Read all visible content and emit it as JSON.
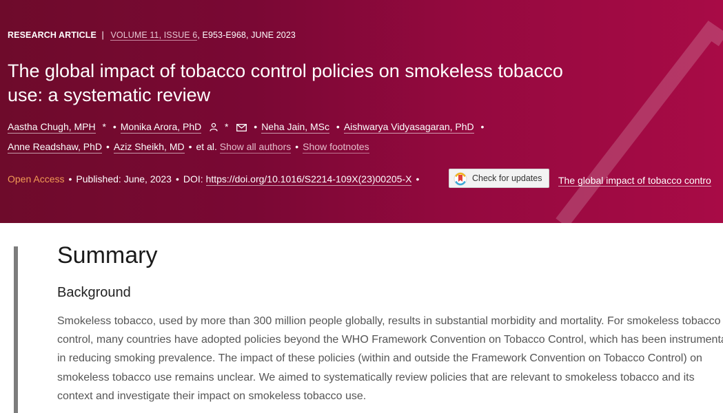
{
  "article": {
    "type": "RESEARCH ARTICLE",
    "separator": "|",
    "volume_issue": "VOLUME 11, ISSUE 6",
    "pages_date": ", E953-E968, JUNE 2023",
    "title": "The global impact of tobacco control policies on smokeless tobacco use: a systematic review"
  },
  "authors": {
    "a1": "Aastha Chugh, MPH",
    "a2": "Monika Arora, PhD",
    "a3": "Neha Jain, MSc",
    "a4": "Aishwarya Vidyasagaran, PhD",
    "a5": "Anne Readshaw, PhD",
    "a6": "Aziz Sheikh, MD",
    "etal": "et al.",
    "show_all": "Show all authors",
    "show_footnotes": "Show footnotes",
    "star": "*",
    "dot": "•"
  },
  "publication": {
    "open_access": "Open Access",
    "published_label": "Published:",
    "published_date": "June, 2023",
    "doi_label": "DOI:",
    "doi": "https://doi.org/10.1016/S2214-109X(23)00205-X",
    "check_updates": "Check for updates",
    "short_title": "The global impact of tobacco contro"
  },
  "summary": {
    "heading": "Summary",
    "subheading": "Background",
    "text": "Smokeless tobacco, used by more than 300 million people globally, results in substantial morbidity and mortality. For smokeless tobacco control, many countries have adopted policies beyond the WHO Framework Convention on Tobacco Control, which has been instrumental in reducing smoking prevalence. The impact of these policies (within and outside the Framework Convention on Tobacco Control) on smokeless tobacco use remains unclear. We aimed to systematically review policies that are relevant to smokeless tobacco and its context and investigate their impact on smokeless tobacco use."
  },
  "colors": {
    "hero_dark": "#6e0b2b",
    "hero_light": "#a80b46",
    "open_access": "#f29a55",
    "summary_bar": "#7d7d7d"
  }
}
